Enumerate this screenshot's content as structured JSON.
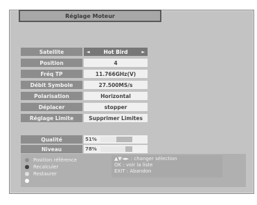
{
  "title": "Réglage Moteur",
  "fields": [
    {
      "label": "Satellite",
      "value": "Hot Bird",
      "selected": true
    },
    {
      "label": "Position",
      "value": "4"
    },
    {
      "label": "Fréq TP",
      "value": "11.766GHz(V)"
    },
    {
      "label": "Débit Symbole",
      "value": "27.500MS/s"
    },
    {
      "label": "Polarisation",
      "value": "Horizontal"
    },
    {
      "label": "Déplacer",
      "value": "stopper"
    },
    {
      "label": "Réglage Limite",
      "value": "Supprimer Limites"
    }
  ],
  "signal": {
    "quality": {
      "label": "Qualité",
      "percent_text": "51%",
      "level": 0.51
    },
    "level": {
      "label": "Niveau",
      "percent_text": "78%",
      "level": 0.78
    }
  },
  "legend": {
    "items": [
      {
        "label": "Position référence",
        "color": "#909090",
        "icon": "gray-circle-icon"
      },
      {
        "label": "Recalculer",
        "color": "#404040",
        "icon": "dark-circle-icon"
      },
      {
        "label": "Restaurer",
        "color": "#e0e0e0",
        "icon": "light-circle-icon"
      },
      {
        "label": "",
        "color": "#ffffff",
        "icon": "white-circle-icon"
      }
    ],
    "hints": [
      "▲▼◄► : changer sélection",
      "OK : voir la liste",
      "EXIT : Abandon"
    ]
  }
}
